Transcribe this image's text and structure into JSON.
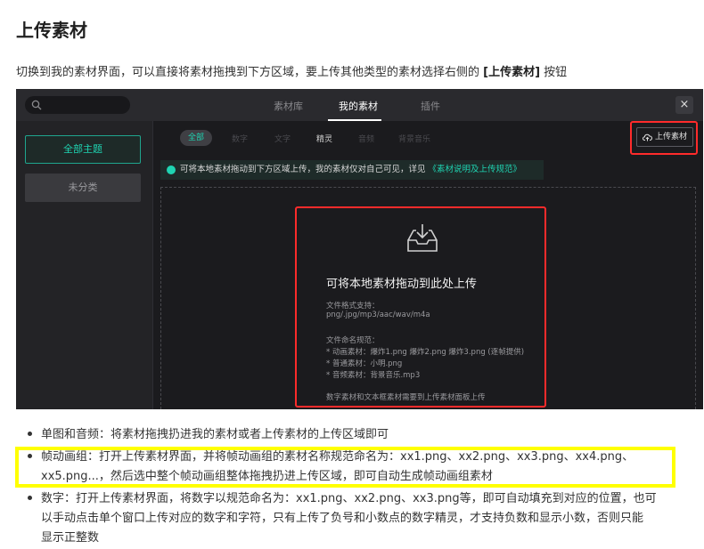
{
  "doc": {
    "title": "上传素材",
    "intro_pre": "切换到我的素材界面，可以直接将素材拖拽到下方区域，要上传其他类型的素材选择右侧的 ",
    "intro_bold": "[上传素材]",
    "intro_post": " 按钮"
  },
  "screenshot": {
    "tabs": [
      "素材库",
      "我的素材",
      "插件"
    ],
    "active_tab": "我的素材",
    "close_icon": "×",
    "sidebar": [
      "全部主题",
      "未分类"
    ],
    "filters": [
      "全部",
      "数字",
      "文字",
      "精灵",
      "音频",
      "背景音乐"
    ],
    "upload_button": "上传素材",
    "notice_text": "可将本地素材拖动到下方区域上传，我的素材仅对自己可见，详见",
    "notice_link": "《素材说明及上传规范》",
    "drop_title": "可将本地素材拖动到此处上传",
    "drop_lines": [
      "文件格式支持：",
      "png/.jpg/mp3/aac/wav/m4a",
      "文件命名规范：",
      "* 动画素材：爆炸1.png 爆炸2.png 爆炸3.png (逐帧提供)",
      "* 普通素材：小明.png",
      "* 音频素材：背景音乐.mp3",
      "数字素材和文本框素材需要到上传素材面板上传"
    ],
    "colors": {
      "accent": "#1fd4b2",
      "highlight_red": "#ff2b2b"
    }
  },
  "bullets": [
    {
      "lines": [
        "单图和音频：将素材拖拽扔进我的素材或者上传素材的上传区域即可"
      ]
    },
    {
      "lines": [
        "帧动画组：打开上传素材界面，并将帧动画组的素材名称规范命名为：xx1.png、xx2.png、xx3.png、xx4.png、",
        "xx5.png...，然后选中整个帧动画组整体拖拽扔进上传区域，即可自动生成帧动画组素材"
      ]
    },
    {
      "lines": [
        "数字：打开上传素材界面，将数字以规范命名为：xx1.png、xx2.png、xx3.png等，即可自动填充到对应的位置，也可",
        "以手动点击单个窗口上传对应的数字和字符，只有上传了负号和小数点的数字精灵，才支持负数和显示小数，否则只能",
        "显示正整数"
      ]
    }
  ],
  "highlight_color": "#ffff00"
}
